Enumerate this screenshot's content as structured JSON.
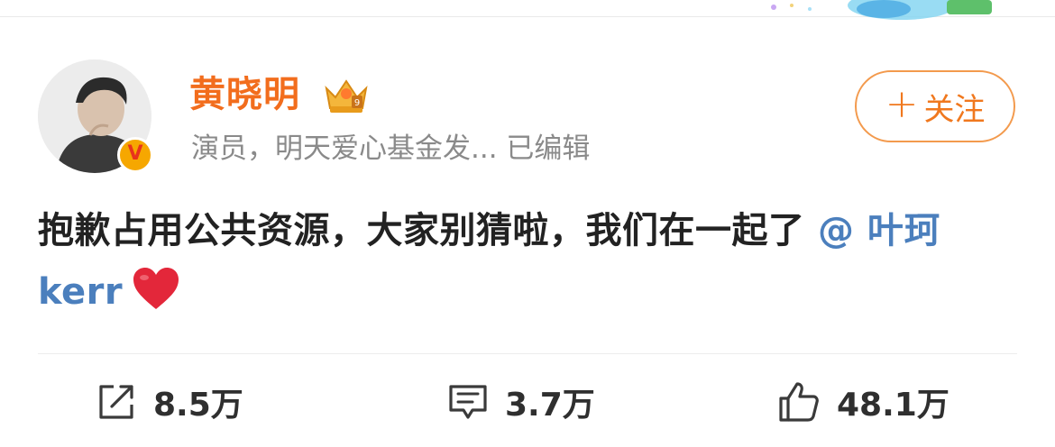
{
  "user": {
    "name": "黄晓明",
    "subtitle": "演员，明天爱心基金发...  已编辑",
    "verified_badge": "V"
  },
  "follow_button": {
    "plus": "+",
    "label": "关注"
  },
  "post": {
    "text": "抱歉占用公共资源，大家别猜啦，我们在一起了 ",
    "mention": "@ 叶珂 kerr",
    "emoji": "heart-emoji"
  },
  "stats": {
    "reposts": "8.5万",
    "comments": "3.7万",
    "likes": "48.1万"
  },
  "colors": {
    "username": "#f26d1d",
    "follow_border": "#f39a4d",
    "mention": "#4b7fbd",
    "heart": "#e3273a"
  }
}
